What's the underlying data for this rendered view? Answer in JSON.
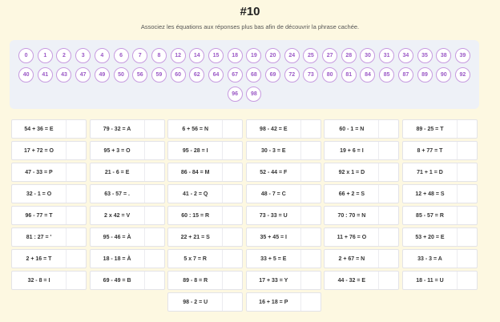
{
  "header": {
    "title": "#10",
    "subtitle": "Associez les équations aux réponses plus bas afin de découvrir la phrase cachée."
  },
  "answers": {
    "row1": [
      "0",
      "1",
      "2",
      "3",
      "4",
      "6",
      "7",
      "8",
      "12",
      "14",
      "15",
      "18",
      "19",
      "20",
      "24",
      "25",
      "27",
      "28",
      "30",
      "31",
      "34",
      "35",
      "38",
      "39"
    ],
    "row2": [
      "40",
      "41",
      "43",
      "47",
      "49",
      "50",
      "56",
      "59",
      "60",
      "62",
      "64",
      "67",
      "68",
      "69",
      "72",
      "73",
      "80",
      "81",
      "84",
      "85",
      "87",
      "89",
      "90",
      "92"
    ],
    "row3": [
      "96",
      "98"
    ]
  },
  "equations": [
    "54 + 36 = E",
    "79 - 32 = A",
    "6 + 56 = N",
    "98 - 42 = E",
    "60 - 1 = N",
    "89 - 25 = T",
    "17 + 72 = O",
    "95 + 3 = O",
    "95 - 28 = I",
    "30 - 3 = E",
    "19 + 6 = I",
    "8 + 77 = T",
    "47 - 33 = P",
    "21 - 6 = E",
    "86 - 84 = M",
    "52 - 44 = F",
    "92 x 1 = D",
    "71 + 1 = D",
    "32 - 1 = O",
    "63 - 57 = .",
    "41 - 2 = Q",
    "48 - 7 = C",
    "66 + 2 = S",
    "12 + 48 = S",
    "96 - 77 = T",
    "2 x 42 = V",
    "60 : 15 = R",
    "73 - 33 = U",
    "70 : 70 = N",
    "85 - 57 = R",
    "81 : 27 = '",
    "95 - 46 = À",
    "22 + 21 = S",
    "35 + 45 = I",
    "11 + 76 = O",
    "53 + 20 = E",
    "2 + 16 = T",
    "18 - 18 = À",
    "5 x 7 = R",
    "33 + 5 = E",
    "2 + 67 = N",
    "33 - 3 = A",
    "32 - 8 = I",
    "69 - 49 = B",
    "89 - 8 = R",
    "17 + 33 = Y",
    "44 - 32 = E",
    "18 - 11 = U",
    "98 - 2 = U",
    "16 + 18 = P"
  ]
}
